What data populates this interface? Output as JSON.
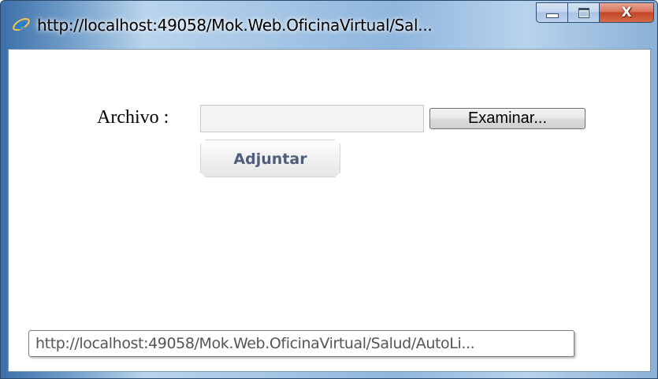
{
  "window": {
    "title": "http://localhost:49058/Mok.Web.OficinaVirtual/Sal...",
    "icon": "ie-icon",
    "caption_buttons": {
      "minimize": "minimize-icon",
      "maximize": "maximize-icon",
      "close": "X"
    }
  },
  "form": {
    "file_label": "Archivo :",
    "file_value": "",
    "browse_label": "Examinar...",
    "attach_label": "Adjuntar"
  },
  "status": {
    "url": "http://localhost:49058/Mok.Web.OficinaVirtual/Salud/AutoLi..."
  },
  "colors": {
    "attach_text": "#4e5d79",
    "close_button": "#c2452a"
  }
}
